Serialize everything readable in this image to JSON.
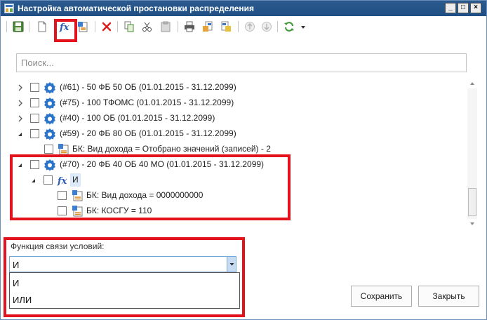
{
  "window": {
    "title": "Настройка автоматической простановки распределения",
    "controls": {
      "minimize": "_",
      "maximize": "□",
      "close": "×"
    }
  },
  "toolbar": {
    "icons": [
      "save-icon",
      "new-document-icon",
      "formula-icon",
      "condition-icon",
      "delete-icon",
      "copy-icon",
      "cut-icon",
      "paste-icon",
      "print-icon",
      "export-icon",
      "import-icon",
      "move-up-icon",
      "move-down-icon",
      "refresh-icon",
      "dropdown-arrow-icon"
    ],
    "highlighted": "formula-icon"
  },
  "search": {
    "placeholder": "Поиск..."
  },
  "tree": {
    "rows": [
      {
        "label": "(#61) - 50 ФБ 50 ОБ (01.01.2015 - 31.12.2099)",
        "expander": "collapsed",
        "icon": "gear-icon"
      },
      {
        "label": "(#75) - 100 ТФОМС (01.01.2015 - 31.12.2099)",
        "expander": "collapsed",
        "icon": "gear-icon"
      },
      {
        "label": "(#40) - 100 ОБ (01.01.2015 - 31.12.2099)",
        "expander": "collapsed",
        "icon": "gear-icon"
      },
      {
        "label": "(#59) - 20 ФБ 80 ОБ (01.01.2015 - 31.12.2099)",
        "expander": "expanded",
        "icon": "gear-icon"
      },
      {
        "label": "БК: Вид дохода = Отобрано значений (записей) - 2",
        "expander": "none",
        "icon": "condition-icon"
      },
      {
        "label": "(#70) - 20 ФБ 40 ОБ 40 МО (01.01.2015 - 31.12.2099)",
        "expander": "expanded",
        "icon": "gear-icon"
      },
      {
        "label": "И",
        "expander": "expanded",
        "icon": "formula-icon"
      },
      {
        "label": "БК: Вид дохода = 0000000000",
        "expander": "none",
        "icon": "condition-icon"
      },
      {
        "label": "БК: КОСГУ = 110",
        "expander": "none",
        "icon": "condition-icon"
      }
    ]
  },
  "link_function": {
    "label": "Функция связи условий:",
    "value": "И",
    "options": [
      "И",
      "ИЛИ"
    ]
  },
  "buttons": {
    "save": "Сохранить",
    "close": "Закрыть"
  },
  "colors": {
    "title_bar": "#1f4f84",
    "highlight": "#e3131e",
    "combo_border": "#7aa7d8",
    "gear": "#2a73c9"
  }
}
